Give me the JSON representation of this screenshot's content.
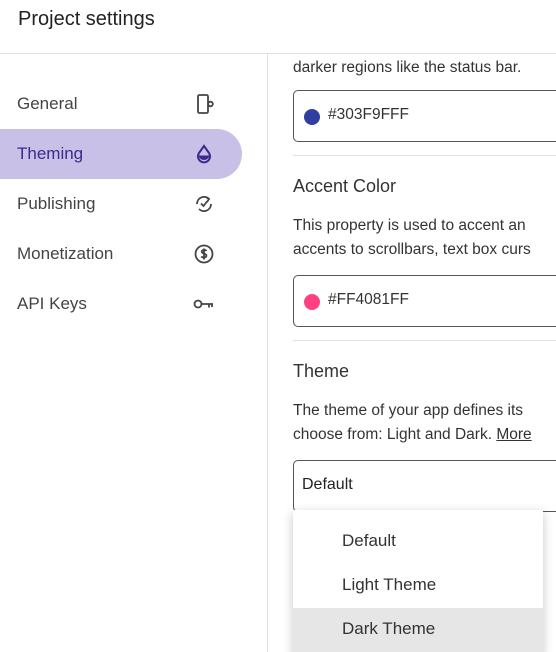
{
  "header": {
    "title": "Project settings"
  },
  "sidebar": {
    "items": [
      {
        "label": "General",
        "icon": "phone-settings-icon",
        "active": false
      },
      {
        "label": "Theming",
        "icon": "water-drop-icon",
        "active": true
      },
      {
        "label": "Publishing",
        "icon": "publish-sync-icon",
        "active": false
      },
      {
        "label": "Monetization",
        "icon": "dollar-circle-icon",
        "active": false
      },
      {
        "label": "API Keys",
        "icon": "key-icon",
        "active": false
      }
    ]
  },
  "content": {
    "primary_dark": {
      "description_tail": "darker regions like the status bar.",
      "value": "#303F9FFF",
      "swatch_color": "#303F9F"
    },
    "accent": {
      "title": "Accent Color",
      "description_line1": "This property is used to accent an",
      "description_line2": "accents to scrollbars, text box curs",
      "value": "#FF4081FF",
      "swatch_color": "#FF4081"
    },
    "theme": {
      "title": "Theme",
      "description_line1": "The theme of your app defines its",
      "description_line2": "choose from: Light and Dark.",
      "more_link": "More",
      "selected": "Default",
      "options": [
        "Default",
        "Light Theme",
        "Dark Theme"
      ],
      "highlighted_option": "Dark Theme"
    }
  },
  "colors": {
    "active_nav_bg": "#c9c0e8",
    "active_nav_text": "#3a2a8a",
    "divider": "#e0e0e0"
  }
}
